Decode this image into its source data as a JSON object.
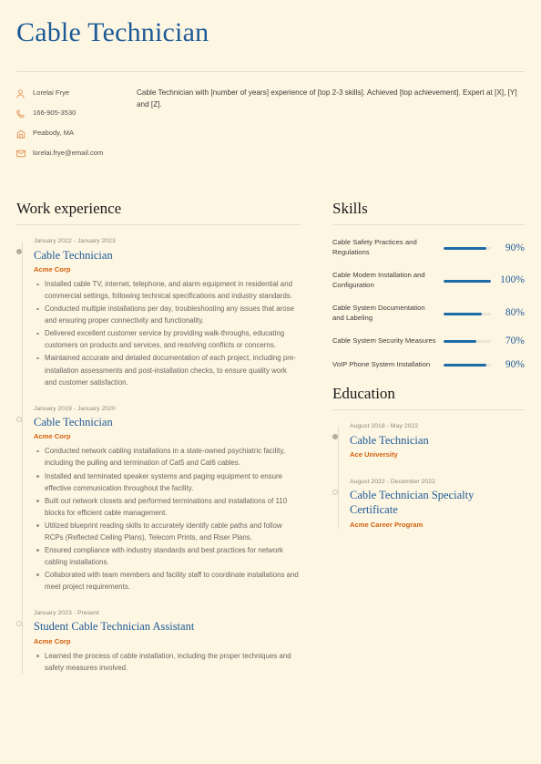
{
  "header": {
    "name": "Cable Technician",
    "contacts": [
      {
        "icon": "person-icon",
        "text": "Lorelai Frye"
      },
      {
        "icon": "phone-icon",
        "text": "166-905-3530"
      },
      {
        "icon": "location-icon",
        "text": "Peabody, MA"
      },
      {
        "icon": "email-icon",
        "text": "lorelai.frye@email.com"
      }
    ],
    "summary": "Cable Technician with [number of years] experience of [top 2-3 skills]. Achieved [top achievement]. Expert at [X], [Y] and [Z]."
  },
  "work": {
    "section_title": "Work experience",
    "entries": [
      {
        "marker": "filled",
        "date": "January 2022 - January 2023",
        "title": "Cable Technician",
        "org": "Acme Corp",
        "bullets": [
          "Installed cable TV, internet, telephone, and alarm equipment in residential and commercial settings, following technical specifications and industry standards.",
          "Conducted multiple installations per day, troubleshooting any issues that arose and ensuring proper connectivity and functionality.",
          "Delivered excellent customer service by providing walk-throughs, educating customers on products and services, and resolving conflicts or concerns.",
          "Maintained accurate and detailed documentation of each project, including pre-installation assessments and post-installation checks, to ensure quality work and customer satisfaction."
        ]
      },
      {
        "marker": "hollow",
        "date": "January 2019 - January 2020",
        "title": "Cable Technician",
        "org": "Acme Corp",
        "bullets": [
          "Conducted network cabling installations in a state-owned psychiatric facility, including the pulling and termination of Cat5 and Cat6 cables.",
          "Installed and terminated speaker systems and paging equipment to ensure effective communication throughout the facility.",
          "Built out network closets and performed terminations and installations of 110 blocks for efficient cable management.",
          "Utilized blueprint reading skills to accurately identify cable paths and follow RCPs (Reflected Ceiling Plans), Telecom Prints, and Riser Plans.",
          "Ensured compliance with industry standards and best practices for network cabling installations.",
          "Collaborated with team members and facility staff to coordinate installations and meet project requirements."
        ]
      },
      {
        "marker": "hollow",
        "date": "January 2023 - Present",
        "title": "Student Cable Technician Assistant",
        "org": "Acme Corp",
        "bullets": [
          "Learned the process of cable installation, including the proper techniques and safety measures involved."
        ]
      }
    ]
  },
  "skills": {
    "section_title": "Skills",
    "items": [
      {
        "name": "Cable Safety Practices and Regulations",
        "percent_label": "90%",
        "percent": 90
      },
      {
        "name": "Cable Modem Installation and Configuration",
        "percent_label": "100%",
        "percent": 100
      },
      {
        "name": "Cable System Documentation and Labeling",
        "percent_label": "80%",
        "percent": 80
      },
      {
        "name": "Cable System Security Measures",
        "percent_label": "70%",
        "percent": 70
      },
      {
        "name": "VoIP Phone System Installation",
        "percent_label": "90%",
        "percent": 90
      }
    ]
  },
  "education": {
    "section_title": "Education",
    "entries": [
      {
        "marker": "filled",
        "date": "August 2018 - May 2022",
        "title": "Cable Technician",
        "org": "Ace University"
      },
      {
        "marker": "hollow",
        "date": "August 2022 - December 2022",
        "title": "Cable Technician Specialty Certificate",
        "org": "Acme Career Program"
      }
    ]
  },
  "colors": {
    "background": "#fdf6e3",
    "accent_blue": "#1d5a96",
    "accent_orange": "#d4600f",
    "bar_blue": "#1d6ca8",
    "rule": "#e7dfc9"
  }
}
